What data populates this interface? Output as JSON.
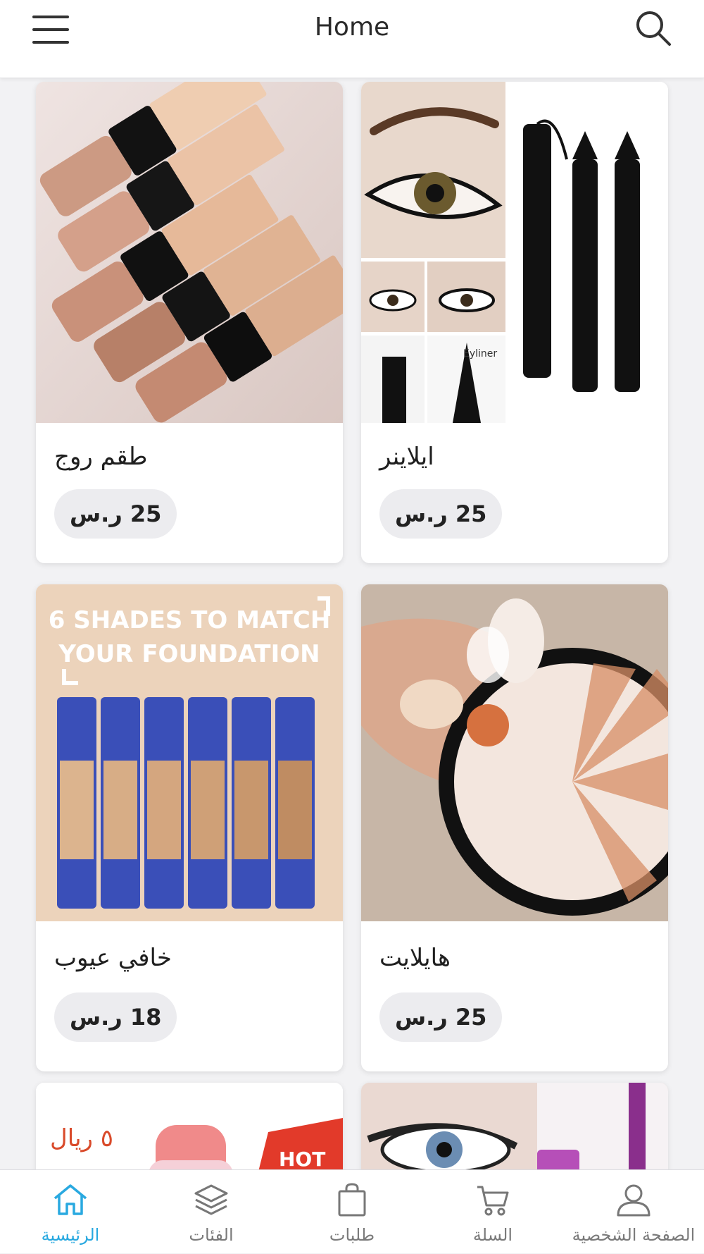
{
  "header": {
    "title": "Home",
    "menu_icon": "hamburger-menu-icon",
    "search_icon": "search-icon"
  },
  "products": [
    {
      "name": "طقم روج",
      "price": "25 ر.س",
      "image": "nude-lipsticks-photo"
    },
    {
      "name": "ايلاينر",
      "price": "25 ر.س",
      "image": "eyeliner-stamp-pen-photo"
    },
    {
      "name": "خافي عيوب",
      "price": "18 ر.س",
      "image": "concealer-tubes-photo",
      "image_text_line1": "6 SHADES TO MATCH",
      "image_text_line2": "YOUR FOUNDATION"
    },
    {
      "name": "هايلايت",
      "price": "25 ر.س",
      "image": "highlighter-palette-photo"
    },
    {
      "image": "makeup-remover-promo-photo",
      "image_text_price": "٥ ريال",
      "image_text_badge": "HOT"
    },
    {
      "image": "mascara-eye-photo"
    }
  ],
  "tabbar": {
    "active_color": "#29a9e0",
    "tabs": [
      {
        "label": "الرئيسية",
        "icon": "home-icon",
        "active": true
      },
      {
        "label": "الفئات",
        "icon": "layers-icon",
        "active": false
      },
      {
        "label": "طلبات",
        "icon": "shopping-bag-icon",
        "active": false
      },
      {
        "label": "السلة",
        "icon": "cart-icon",
        "active": false
      },
      {
        "label": "الصفحة الشخصية",
        "icon": "user-icon",
        "active": false
      }
    ]
  }
}
